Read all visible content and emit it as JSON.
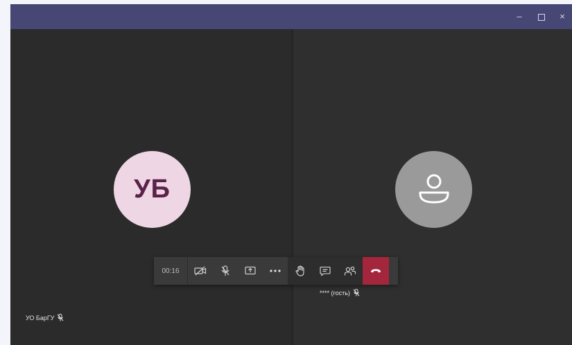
{
  "window": {
    "controls": {
      "minimize_label": "–",
      "close_label": "×"
    }
  },
  "participants": [
    {
      "initials": "УБ",
      "name": "УО БарГУ",
      "avatar_color": "#eed6e5",
      "initials_color": "#5b2249",
      "mic": "muted"
    },
    {
      "name": "**** (гость)",
      "avatar_color": "#9a9a9a",
      "mic": "muted"
    }
  ],
  "toolbar": {
    "timer": "00:16",
    "buttons": [
      {
        "name": "camera-off",
        "icon": "video-off-icon"
      },
      {
        "name": "mic",
        "icon": "mic-icon"
      },
      {
        "name": "share",
        "icon": "share-screen-icon"
      },
      {
        "name": "more",
        "icon": "more-icon"
      },
      {
        "name": "raise-hand",
        "icon": "hand-icon"
      },
      {
        "name": "chat",
        "icon": "chat-icon"
      },
      {
        "name": "participants",
        "icon": "people-icon"
      },
      {
        "name": "hang-up",
        "icon": "phone-hangup-icon",
        "color": "#a4263c"
      }
    ]
  },
  "colors": {
    "titlebar": "#464775",
    "stage": "#2b2b2b",
    "toolbar": "#3a3a3a"
  }
}
